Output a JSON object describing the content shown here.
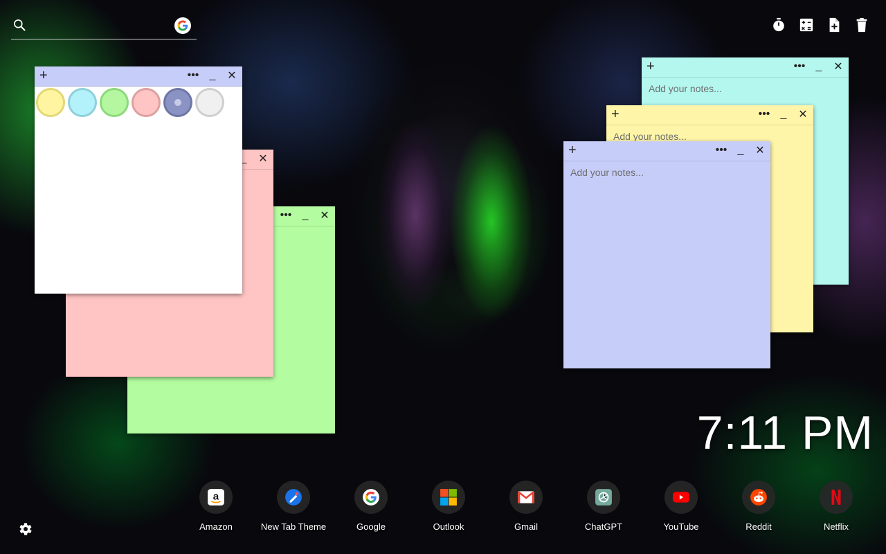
{
  "search": {
    "placeholder": "",
    "engine_icon": "google-icon"
  },
  "toolbar": {
    "icons": [
      "timer-icon",
      "calculator-icon",
      "new-note-icon",
      "trash-icon"
    ]
  },
  "notes": [
    {
      "color": "#b3f7ee",
      "bar_color": "#b3f7ee",
      "placeholder": "Add your notes..."
    },
    {
      "color": "#fff5a8",
      "bar_color": "#fff5a8",
      "placeholder": "Add your notes..."
    },
    {
      "color": "#c6cdf9",
      "bar_color": "#c6cdf9",
      "placeholder": "Add your notes..."
    },
    {
      "color": "#b3fca0",
      "bar_color": "#b3fca0",
      "placeholder": ""
    },
    {
      "color": "#ffc4c4",
      "bar_color": "#ffc4c4",
      "placeholder": ""
    },
    {
      "color": "#ffffff",
      "bar_color": "#c6cdf9",
      "placeholder": ""
    }
  ],
  "palette": [
    {
      "name": "yellow",
      "color": "#fff5a0"
    },
    {
      "name": "cyan",
      "color": "#b3f2fb"
    },
    {
      "name": "green",
      "color": "#b5f7a0"
    },
    {
      "name": "pink",
      "color": "#ffc4c4"
    },
    {
      "name": "blue",
      "color": "#8a93c4",
      "selected": true
    },
    {
      "name": "white",
      "color": "#f0f0f0"
    }
  ],
  "clock": {
    "time": "7:11 PM"
  },
  "apps": [
    {
      "label": "Amazon",
      "icon": "amazon-icon"
    },
    {
      "label": "New Tab Theme",
      "icon": "new-tab-theme-icon"
    },
    {
      "label": "Google",
      "icon": "google-icon"
    },
    {
      "label": "Outlook",
      "icon": "outlook-icon"
    },
    {
      "label": "Gmail",
      "icon": "gmail-icon"
    },
    {
      "label": "ChatGPT",
      "icon": "chatgpt-icon"
    },
    {
      "label": "YouTube",
      "icon": "youtube-icon"
    },
    {
      "label": "Reddit",
      "icon": "reddit-icon"
    },
    {
      "label": "Netflix",
      "icon": "netflix-icon"
    }
  ],
  "settings": {
    "icon": "gear-icon"
  }
}
